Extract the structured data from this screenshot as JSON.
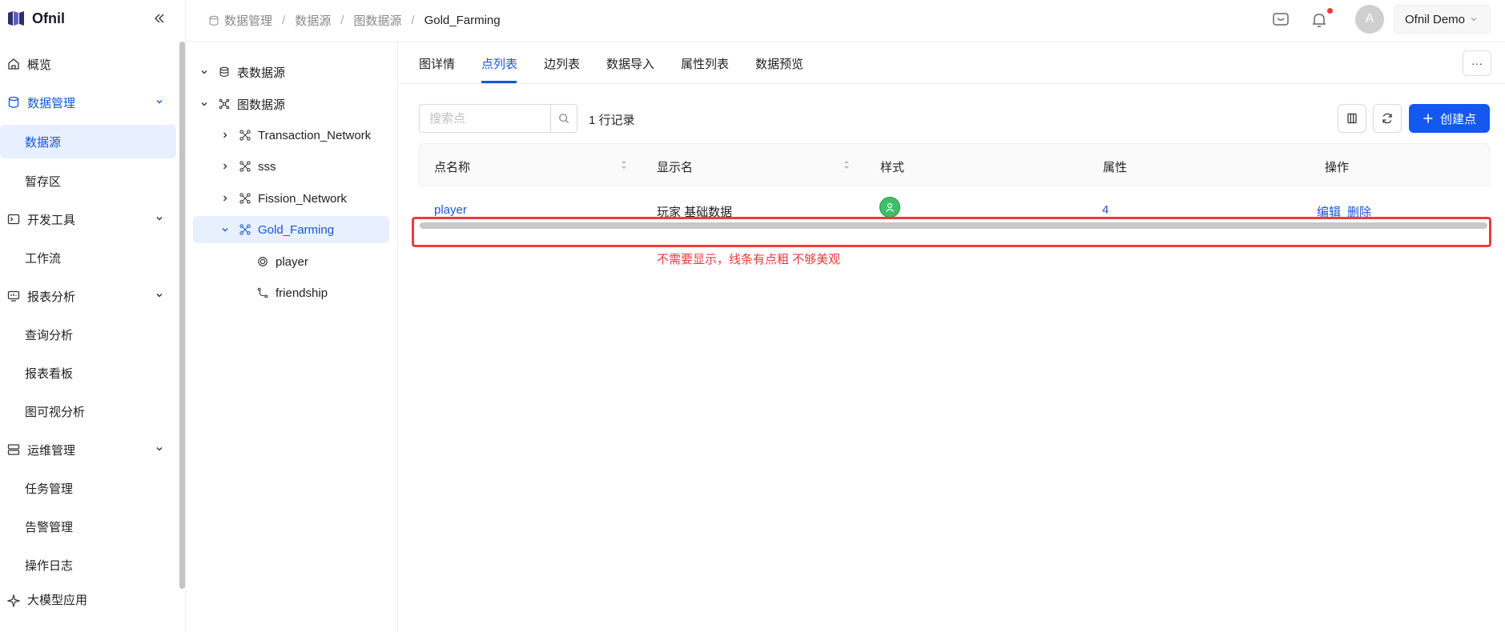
{
  "app": {
    "name": "Ofnil",
    "brand_color": "#1558d6"
  },
  "sidebar": {
    "groups": [
      {
        "label": "概览",
        "icon": "home-icon"
      },
      {
        "label": "数据管理",
        "icon": "database-icon",
        "expanded": true,
        "items": [
          "数据源",
          "暂存区"
        ]
      },
      {
        "label": "开发工具",
        "icon": "terminal-icon",
        "items": [
          "工作流"
        ]
      },
      {
        "label": "报表分析",
        "icon": "chart-icon",
        "items": [
          "查询分析",
          "报表看板",
          "图可视分析"
        ]
      },
      {
        "label": "运维管理",
        "icon": "server-icon",
        "items": [
          "任务管理",
          "告警管理",
          "操作日志"
        ]
      },
      {
        "label": "大模型应用",
        "icon": "sparkle-icon"
      }
    ],
    "selected_item": "数据源"
  },
  "header": {
    "breadcrumb": [
      "数据管理",
      "数据源",
      "图数据源",
      "Gold_Farming"
    ],
    "avatar_initial": "A",
    "user_name": "Ofnil Demo"
  },
  "tree": {
    "table_source": "表数据源",
    "graph_source": "图数据源",
    "graphs": [
      "Transaction_Network",
      "sss",
      "Fission_Network",
      "Gold_Farming"
    ],
    "children": [
      "player",
      "friendship"
    ]
  },
  "tabs": [
    "图详情",
    "点列表",
    "边列表",
    "数据导入",
    "属性列表",
    "数据预览"
  ],
  "active_tab": "点列表",
  "toolbar": {
    "search_placeholder": "搜索点",
    "record_count": "1 行记录",
    "create_label": "创建点"
  },
  "table": {
    "columns": [
      "点名称",
      "显示名",
      "样式",
      "属性",
      "操作"
    ],
    "rows": [
      {
        "name": "player",
        "display_name": "玩家 基础数据",
        "attributes": "4",
        "actions": [
          "编辑",
          "删除"
        ]
      }
    ]
  },
  "annotation": {
    "text": "不需要显示，线条有点粗 不够美观",
    "color": "#e83a3a"
  }
}
